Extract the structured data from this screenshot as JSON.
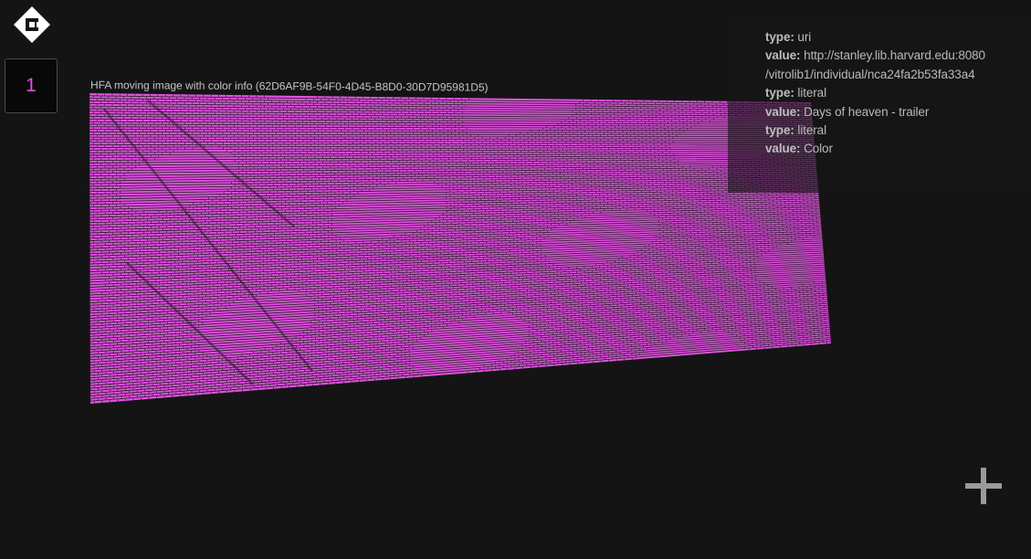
{
  "page_counter": {
    "value": "1"
  },
  "image_object": {
    "title": "HFA moving image with color info (62D6AF9B-54F0-4D45-B8D0-30D7D95981D5)",
    "fill_color": "#e052e0",
    "line_color": "#161616"
  },
  "info_panel": {
    "rows": [
      {
        "key": "type:",
        "value": "uri"
      },
      {
        "key": "value:",
        "value": "http://stanley.lib.harvard.edu:8080"
      },
      {
        "key": "",
        "value": "/vitrolib1/individual/nca24fa2b53fa33a4"
      },
      {
        "key": "type:",
        "value": "literal"
      },
      {
        "key": "value:",
        "value": "Days of heaven - trailer"
      },
      {
        "key": "type:",
        "value": "literal"
      },
      {
        "key": "value:",
        "value": "Color"
      }
    ]
  },
  "icons": {
    "logo": "logo-icon",
    "add": "plus-icon"
  },
  "colors": {
    "background": "#141414",
    "accent": "#e052e0",
    "text": "#c8c8c8"
  }
}
